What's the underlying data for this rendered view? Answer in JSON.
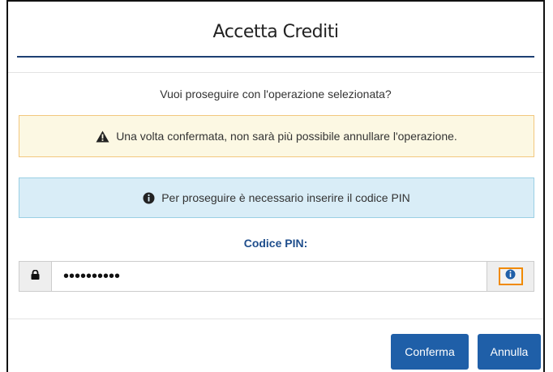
{
  "dialog": {
    "title": "Accetta Crediti",
    "question": "Vuoi proseguire con l'operazione selezionata?",
    "warning_text": "Una volta confermata, non sarà più possibile annullare l'operazione.",
    "info_text": "Per proseguire è necessario inserire il codice PIN",
    "pin_label": "Codice PIN:",
    "pin_value": "••••••••••",
    "confirm_label": "Conferma",
    "cancel_label": "Annulla"
  },
  "icons": {
    "warning": "warning-triangle-icon",
    "info": "info-circle-icon",
    "lock": "lock-icon",
    "pin_info": "info-circle-icon"
  },
  "colors": {
    "primary": "#1f5fa8",
    "title_rule": "#1d3f73",
    "warning_bg": "#fcf8e3",
    "warning_border": "#f2c77e",
    "info_bg": "#d9edf7",
    "info_border": "#9acfe4",
    "pin_label": "#1f4e8c",
    "highlight": "#f08a00"
  }
}
